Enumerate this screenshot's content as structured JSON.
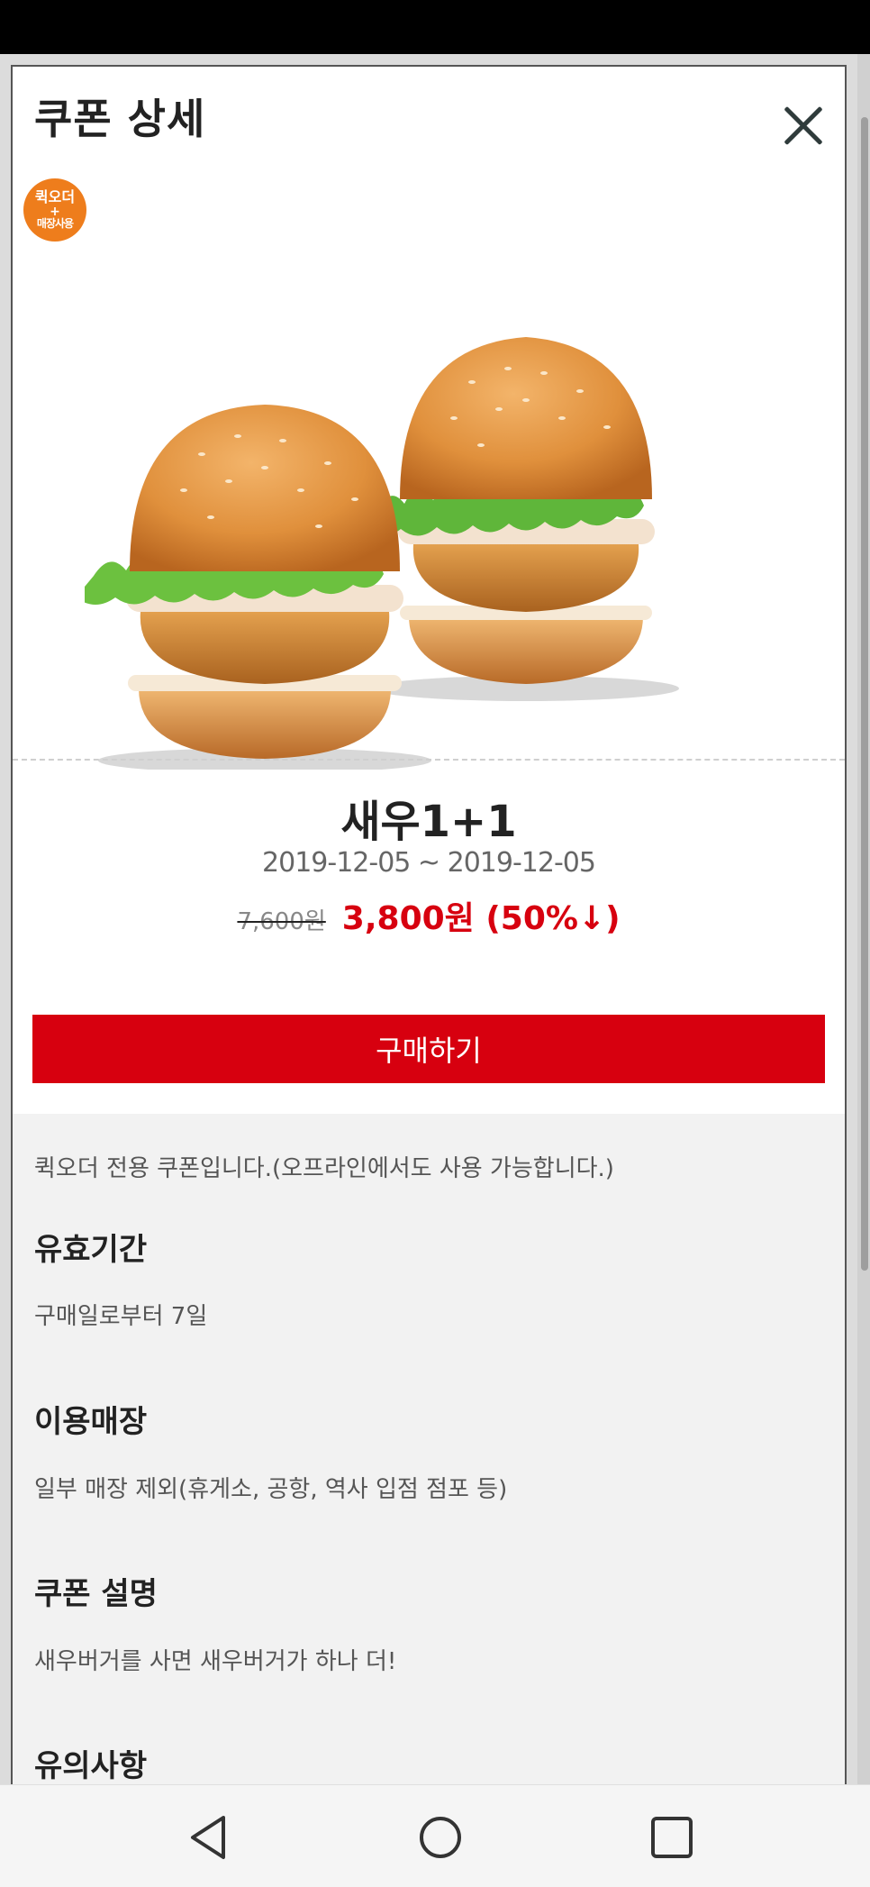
{
  "modal": {
    "title": "쿠폰 상세",
    "close_icon": "close-icon"
  },
  "badge": {
    "line1": "퀵오더",
    "line2": "+",
    "line3": "매장사용",
    "color": "#ee7d1c"
  },
  "product": {
    "name": "새우1+1",
    "dates": "2019-12-05 ~ 2019-12-05",
    "original_price": "7,600원",
    "sale_price": "3,800원 (50%↓)"
  },
  "buy_button": {
    "label": "구매하기",
    "color": "#d7000f"
  },
  "details": {
    "notice": "퀵오더 전용 쿠폰입니다.(오프라인에서도 사용 가능합니다.)",
    "sections": [
      {
        "heading": "유효기간",
        "text": "구매일로부터 7일"
      },
      {
        "heading": "이용매장",
        "text": "일부 매장 제외(휴게소, 공항, 역사 입점 점포 등)"
      },
      {
        "heading": "쿠폰 설명",
        "text": "새우버거를 사면 새우버거가 하나 더!"
      },
      {
        "heading": "유의사항"
      }
    ]
  },
  "nav": {
    "back_icon": "back-triangle-icon",
    "home_icon": "home-circle-icon",
    "recent_icon": "recent-apps-square-icon"
  }
}
